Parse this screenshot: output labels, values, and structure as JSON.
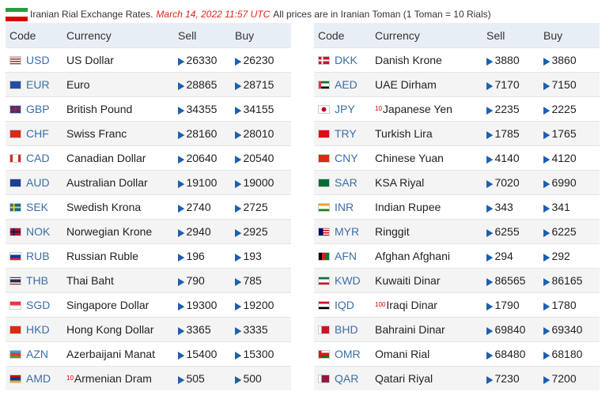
{
  "header": {
    "prefix": "Iranian Rial Exchange Rates.",
    "date": "March 14, 2022 11:57 UTC",
    "suffix": "All prices are in Iranian Toman (1 Toman = 10 Rials)",
    "flag_icon": "iran-flag-icon"
  },
  "columns": {
    "code": "Code",
    "currency": "Currency",
    "sell": "Sell",
    "buy": "Buy"
  },
  "colors": {
    "header_bg": "#e7eef6",
    "code_link": "#3b6ea8",
    "arrow": "#1a5fb4",
    "date": "#e0261a"
  },
  "left": [
    {
      "code": "USD",
      "name": "US Dollar",
      "sell": "26330",
      "buy": "26230",
      "mult": "",
      "flag": "us-flag-icon"
    },
    {
      "code": "EUR",
      "name": "Euro",
      "sell": "28865",
      "buy": "28715",
      "mult": "",
      "flag": "eu-flag-icon"
    },
    {
      "code": "GBP",
      "name": "British Pound",
      "sell": "34355",
      "buy": "34155",
      "mult": "",
      "flag": "gb-flag-icon"
    },
    {
      "code": "CHF",
      "name": "Swiss Franc",
      "sell": "28160",
      "buy": "28010",
      "mult": "",
      "flag": "ch-flag-icon"
    },
    {
      "code": "CAD",
      "name": "Canadian Dollar",
      "sell": "20640",
      "buy": "20540",
      "mult": "",
      "flag": "ca-flag-icon"
    },
    {
      "code": "AUD",
      "name": "Australian Dollar",
      "sell": "19100",
      "buy": "19000",
      "mult": "",
      "flag": "au-flag-icon"
    },
    {
      "code": "SEK",
      "name": "Swedish Krona",
      "sell": "2740",
      "buy": "2725",
      "mult": "",
      "flag": "se-flag-icon"
    },
    {
      "code": "NOK",
      "name": "Norwegian Krone",
      "sell": "2940",
      "buy": "2925",
      "mult": "",
      "flag": "no-flag-icon"
    },
    {
      "code": "RUB",
      "name": "Russian Ruble",
      "sell": "196",
      "buy": "193",
      "mult": "",
      "flag": "ru-flag-icon"
    },
    {
      "code": "THB",
      "name": "Thai Baht",
      "sell": "790",
      "buy": "785",
      "mult": "",
      "flag": "th-flag-icon"
    },
    {
      "code": "SGD",
      "name": "Singapore Dollar",
      "sell": "19300",
      "buy": "19200",
      "mult": "",
      "flag": "sg-flag-icon"
    },
    {
      "code": "HKD",
      "name": "Hong Kong Dollar",
      "sell": "3365",
      "buy": "3335",
      "mult": "",
      "flag": "hk-flag-icon"
    },
    {
      "code": "AZN",
      "name": "Azerbaijani Manat",
      "sell": "15400",
      "buy": "15300",
      "mult": "",
      "flag": "az-flag-icon"
    },
    {
      "code": "AMD",
      "name": "Armenian Dram",
      "sell": "505",
      "buy": "500",
      "mult": "10",
      "flag": "am-flag-icon"
    }
  ],
  "right": [
    {
      "code": "DKK",
      "name": "Danish Krone",
      "sell": "3880",
      "buy": "3860",
      "mult": "",
      "flag": "dk-flag-icon"
    },
    {
      "code": "AED",
      "name": "UAE Dirham",
      "sell": "7170",
      "buy": "7150",
      "mult": "",
      "flag": "ae-flag-icon"
    },
    {
      "code": "JPY",
      "name": "Japanese Yen",
      "sell": "2235",
      "buy": "2225",
      "mult": "10",
      "flag": "jp-flag-icon"
    },
    {
      "code": "TRY",
      "name": "Turkish Lira",
      "sell": "1785",
      "buy": "1765",
      "mult": "",
      "flag": "tr-flag-icon"
    },
    {
      "code": "CNY",
      "name": "Chinese Yuan",
      "sell": "4140",
      "buy": "4120",
      "mult": "",
      "flag": "cn-flag-icon"
    },
    {
      "code": "SAR",
      "name": "KSA Riyal",
      "sell": "7020",
      "buy": "6990",
      "mult": "",
      "flag": "sa-flag-icon"
    },
    {
      "code": "INR",
      "name": "Indian Rupee",
      "sell": "343",
      "buy": "341",
      "mult": "",
      "flag": "in-flag-icon"
    },
    {
      "code": "MYR",
      "name": "Ringgit",
      "sell": "6255",
      "buy": "6225",
      "mult": "",
      "flag": "my-flag-icon"
    },
    {
      "code": "AFN",
      "name": "Afghan Afghani",
      "sell": "294",
      "buy": "292",
      "mult": "",
      "flag": "af-flag-icon"
    },
    {
      "code": "KWD",
      "name": "Kuwaiti Dinar",
      "sell": "86565",
      "buy": "86165",
      "mult": "",
      "flag": "kw-flag-icon"
    },
    {
      "code": "IQD",
      "name": "Iraqi Dinar",
      "sell": "1790",
      "buy": "1780",
      "mult": "100",
      "flag": "iq-flag-icon"
    },
    {
      "code": "BHD",
      "name": "Bahraini Dinar",
      "sell": "69840",
      "buy": "69340",
      "mult": "",
      "flag": "bh-flag-icon"
    },
    {
      "code": "OMR",
      "name": "Omani Rial",
      "sell": "68480",
      "buy": "68180",
      "mult": "",
      "flag": "om-flag-icon"
    },
    {
      "code": "QAR",
      "name": "Qatari Riyal",
      "sell": "7230",
      "buy": "7200",
      "mult": "",
      "flag": "qa-flag-icon"
    }
  ]
}
